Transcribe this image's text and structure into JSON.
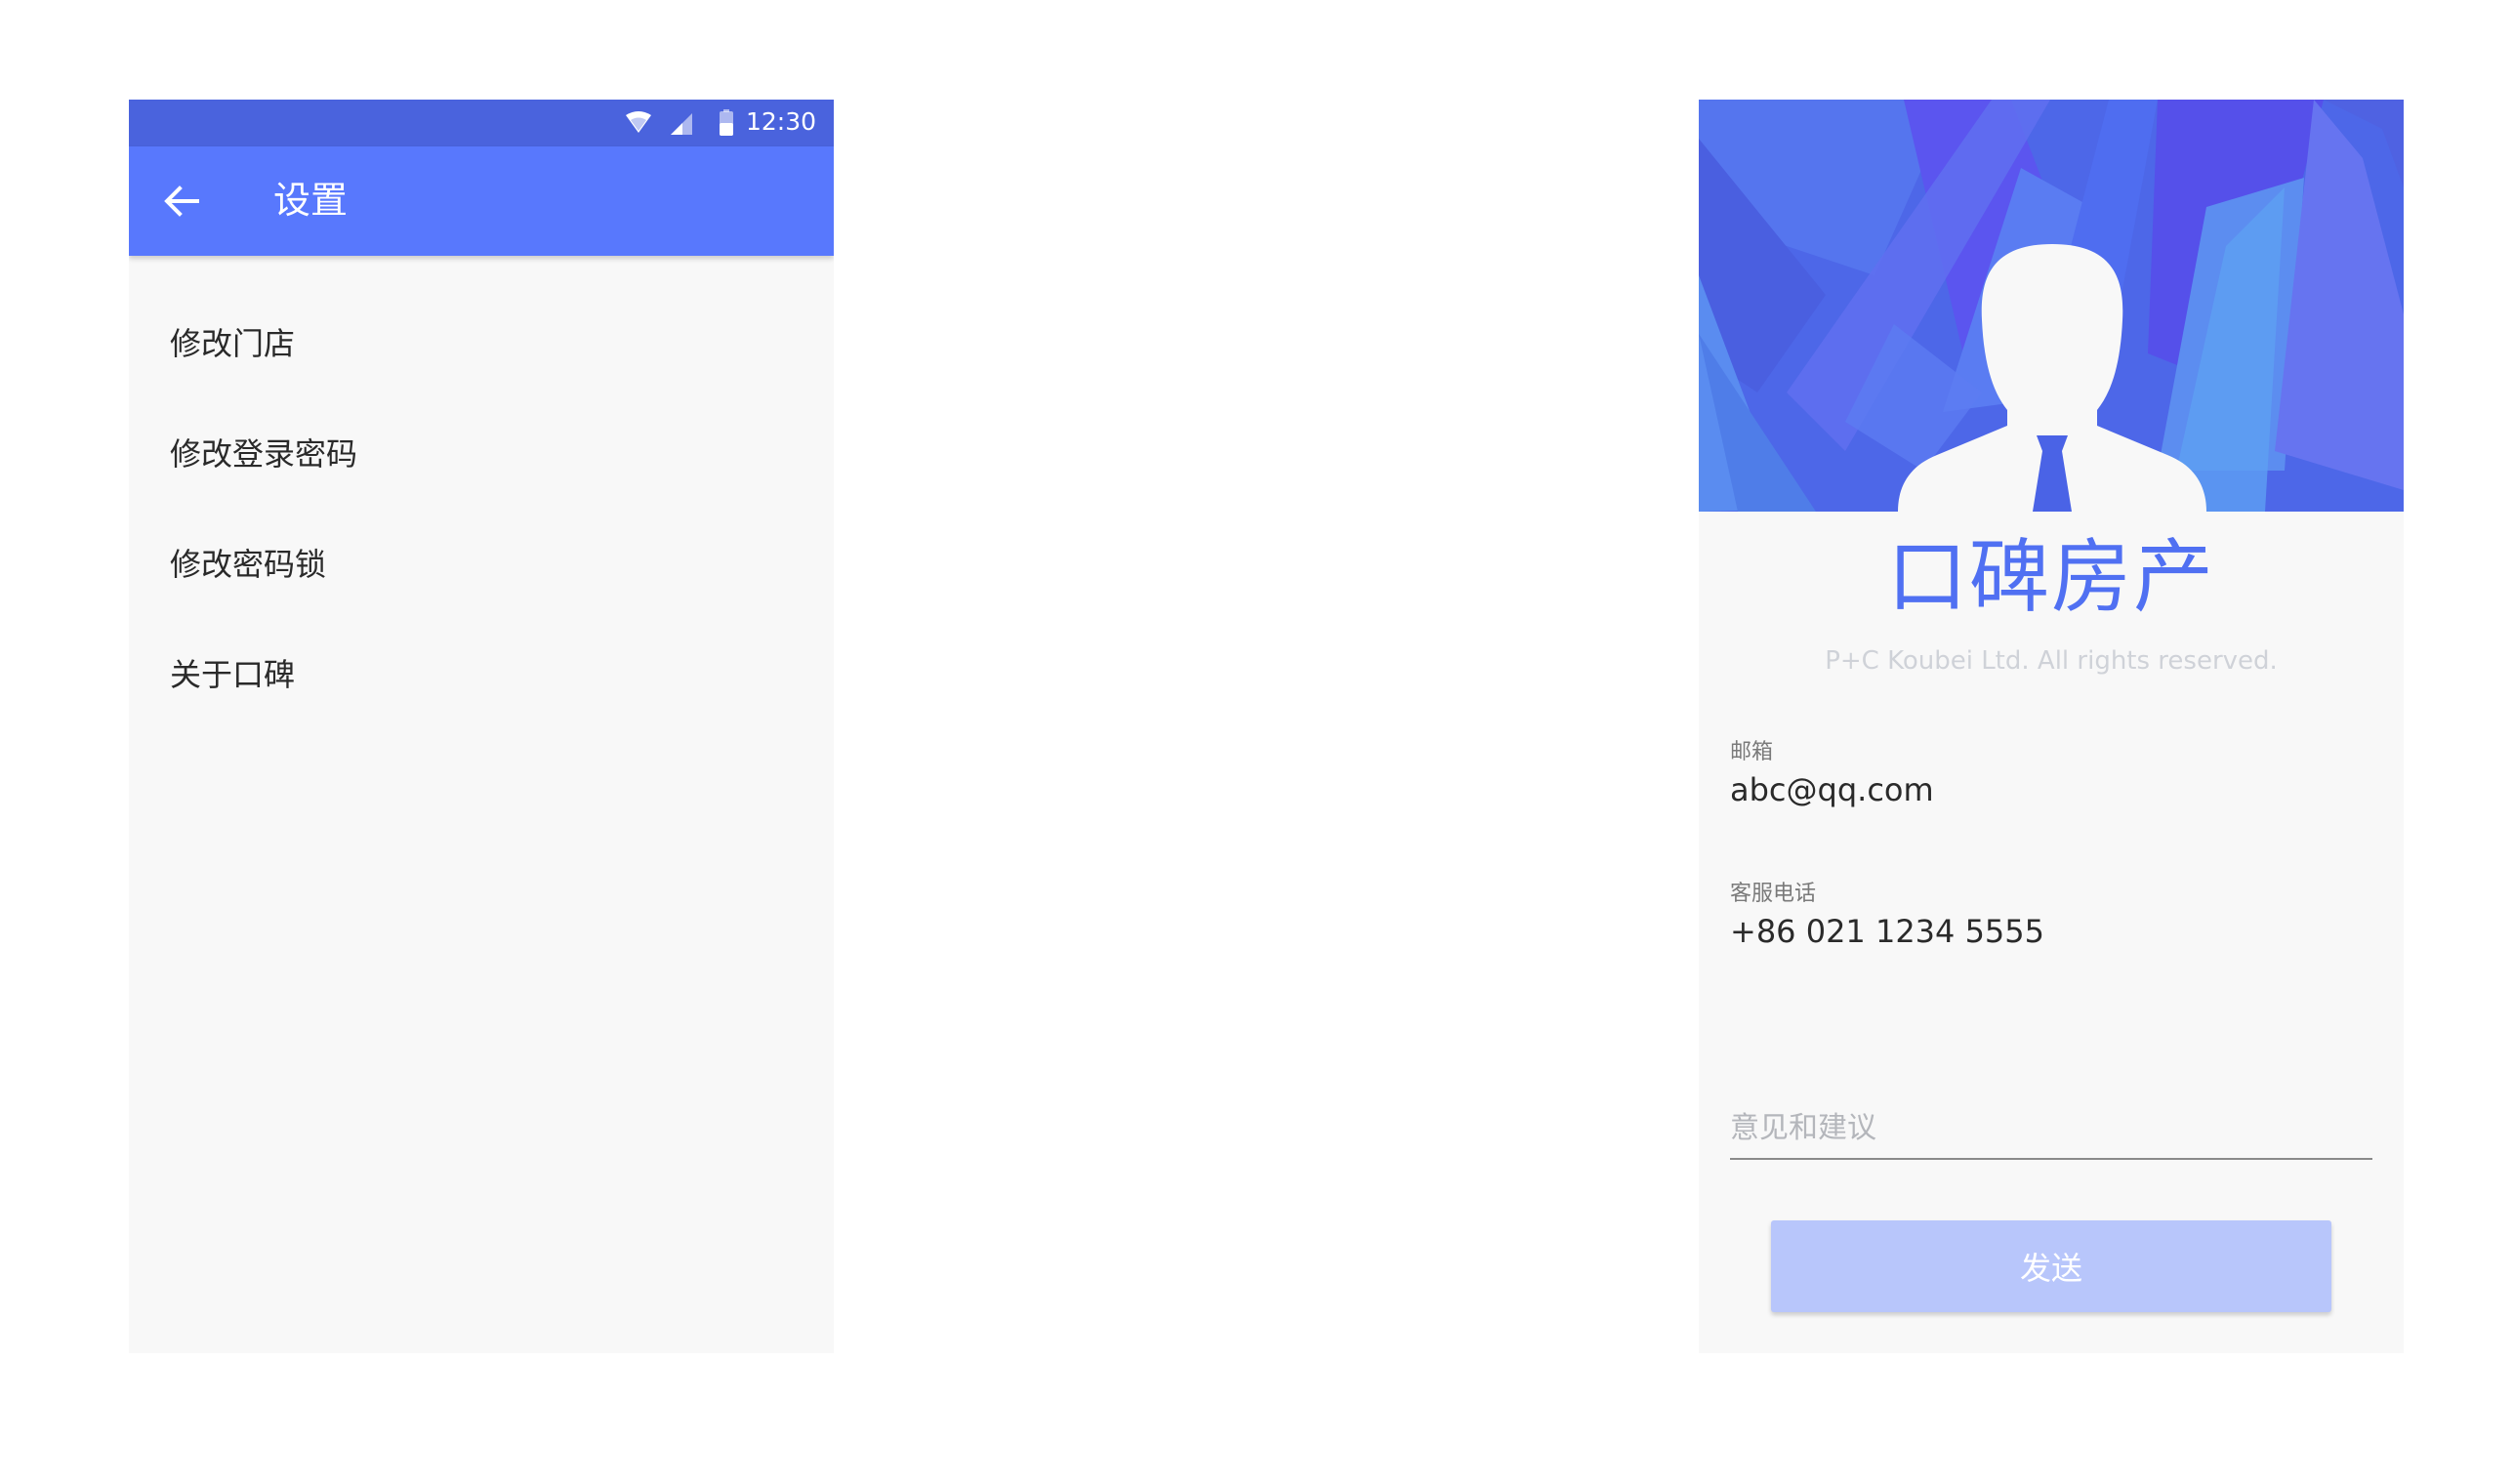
{
  "settings_screen": {
    "status_bar": {
      "time": "12:30"
    },
    "app_bar": {
      "title": "设置"
    },
    "menu_items": [
      {
        "label": "修改门店"
      },
      {
        "label": "修改登录密码"
      },
      {
        "label": "修改密码锁"
      },
      {
        "label": "关于口碑"
      }
    ]
  },
  "about_screen": {
    "brand_name": "口碑房产",
    "copyright": "P+C Koubei Ltd. All rights reserved.",
    "email": {
      "label": "邮箱",
      "value": "abc@qq.com"
    },
    "phone": {
      "label": "客服电话",
      "value": "+86 021 1234 5555"
    },
    "feedback": {
      "placeholder": "意见和建议",
      "value": ""
    },
    "send_button": {
      "label": "发送"
    }
  },
  "colors": {
    "primary": "#5878fd",
    "status_bar": "#4a63dd",
    "brand_text": "#5070f2",
    "send_button_disabled": "#b8c6fb",
    "screen_background": "#f8f8f8"
  },
  "icons": [
    "wifi-icon",
    "signal-icon",
    "battery-icon",
    "arrow-left-icon",
    "user-silhouette-icon"
  ]
}
